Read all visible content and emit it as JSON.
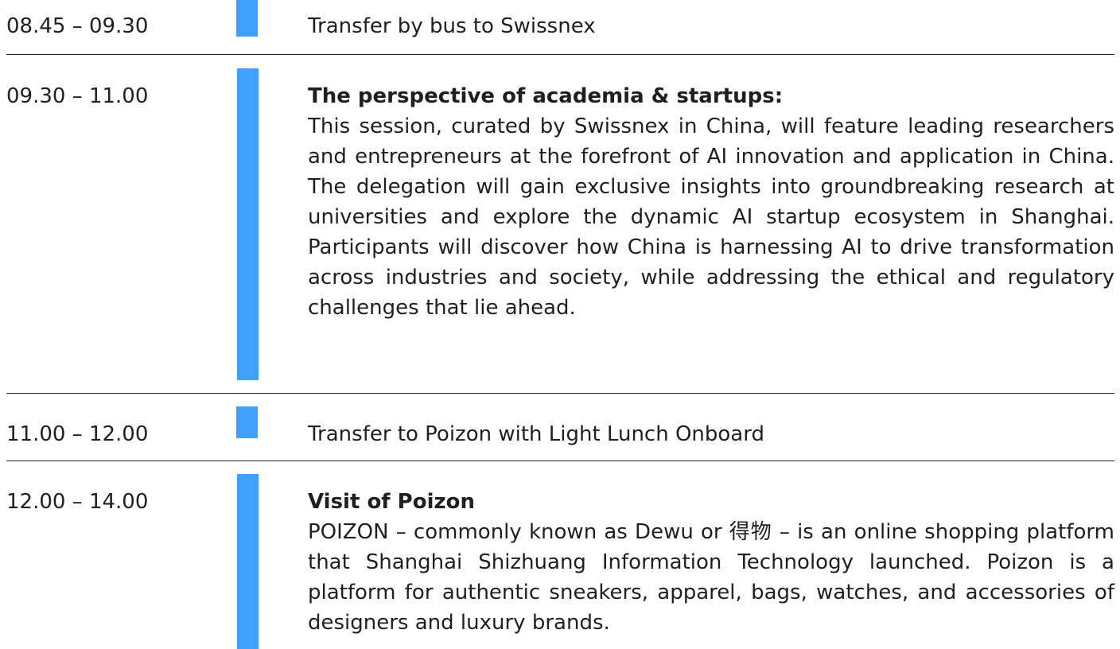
{
  "schedule": [
    {
      "time": "08.45 – 09.30",
      "text": "Transfer by bus to Swissnex"
    },
    {
      "time": "09.30 – 11.00",
      "title": "The perspective of academia & startups:",
      "description": "This session, curated by Swissnex in China, will feature leading re­searchers and entrepreneurs at the forefront of AI innovation and application in China. The delegation will gain exclusive insights into groundbreaking research at universities and explore the dynamic AI startup ecosystem in Shanghai. Participants will discover how China is harnessing AI to drive transformation across industries and society, while addressing the ethical and regulatory challenges that lie ahead."
    },
    {
      "time": "11.00 – 12.00",
      "text": "Transfer to Poizon with Light Lunch Onboard"
    },
    {
      "time": "12.00 – 14.00",
      "title": "Visit of Poizon",
      "description": "POIZON – commonly known as Dewu or 得物 – is an online shopping platform that Shanghai Shizhuang Information Technology laun­ched. Poizon is a platform for authentic sneakers, apparel, bags, watches, and accessories of designers and luxury brands."
    }
  ],
  "colors": {
    "accent_bar": "#3fa0ff",
    "divider": "#222222",
    "text": "#1f1f1f"
  }
}
